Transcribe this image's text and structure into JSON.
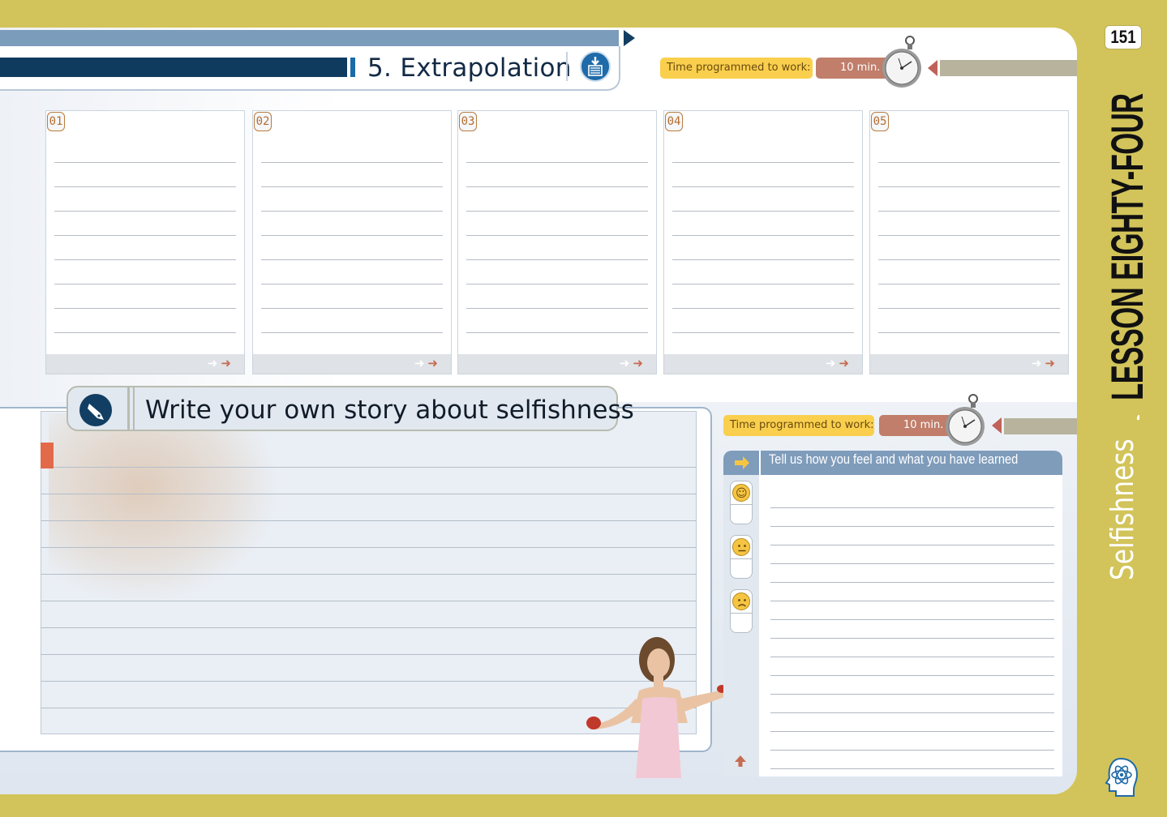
{
  "page": {
    "number": "151"
  },
  "side": {
    "lesson": "LESSON EIGHTY-FOUR",
    "topic": "Selfishness"
  },
  "section": {
    "title": "5. Extrapolation",
    "timer_label": "Time programmed to work:",
    "timer_value": "10 min."
  },
  "columns": [
    {
      "num": "01"
    },
    {
      "num": "02"
    },
    {
      "num": "03"
    },
    {
      "num": "04"
    },
    {
      "num": "05"
    }
  ],
  "story": {
    "title": "Write your own story about selfishness"
  },
  "feelings": {
    "timer_label": "Time programmed to work:",
    "timer_value": "10 min.",
    "title": "Tell us how you feel and what you have learned"
  },
  "icons": {
    "download": "download-list-icon",
    "pen": "pen-nib-icon",
    "stopwatch": "stopwatch-icon",
    "atom": "atom-head-icon",
    "faces": [
      "happy-face-icon",
      "neutral-face-icon",
      "sad-face-icon"
    ]
  },
  "colors": {
    "frame": "#d2c45a",
    "navy": "#0f3b5f",
    "steel_blue": "#7f9cbb",
    "timer_yellow": "#f9cf4d",
    "timer_rust": "#c07e6b",
    "arrow_red": "#c56c52"
  }
}
